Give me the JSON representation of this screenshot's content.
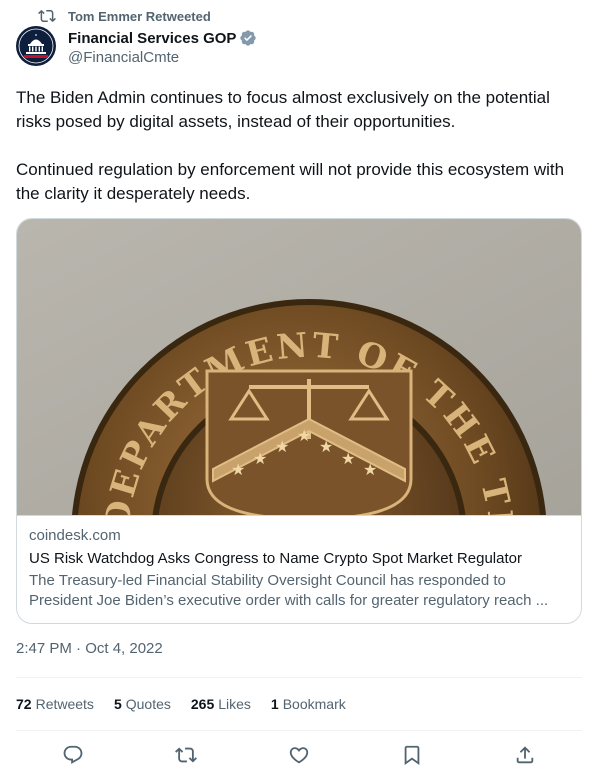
{
  "retweet": {
    "text": "Tom Emmer Retweeted"
  },
  "author": {
    "name": "Financial Services GOP",
    "handle": "@FinancialCmte",
    "verified_color": "#829aab"
  },
  "tweet": {
    "paragraphs": [
      "The Biden Admin continues to focus almost exclusively on the potential risks posed by digital assets, instead of their opportunities.",
      "Continued regulation by enforcement will not provide this ecosystem with the clarity it desperately needs."
    ]
  },
  "card": {
    "image_seal_text": "DEPARTMENT OF THE TREASURY",
    "domain": "coindesk.com",
    "title": "US Risk Watchdog Asks Congress to Name Crypto Spot Market Regulator",
    "description": "The Treasury-led Financial Stability Oversight Council has responded to President Joe Biden’s executive order with calls for greater regulatory reach ..."
  },
  "timestamp": "2:47 PM · Oct 4, 2022",
  "stats": {
    "retweets": {
      "count": "72",
      "label": "Retweets"
    },
    "quotes": {
      "count": "5",
      "label": "Quotes"
    },
    "likes": {
      "count": "265",
      "label": "Likes"
    },
    "bookmarks": {
      "count": "1",
      "label": "Bookmark"
    }
  },
  "actions": [
    "reply-icon",
    "retweet-icon",
    "like-icon",
    "bookmark-icon",
    "share-icon"
  ],
  "colors": {
    "text": "#0f1419",
    "secondary": "#536471",
    "border": "#cfd9de"
  }
}
